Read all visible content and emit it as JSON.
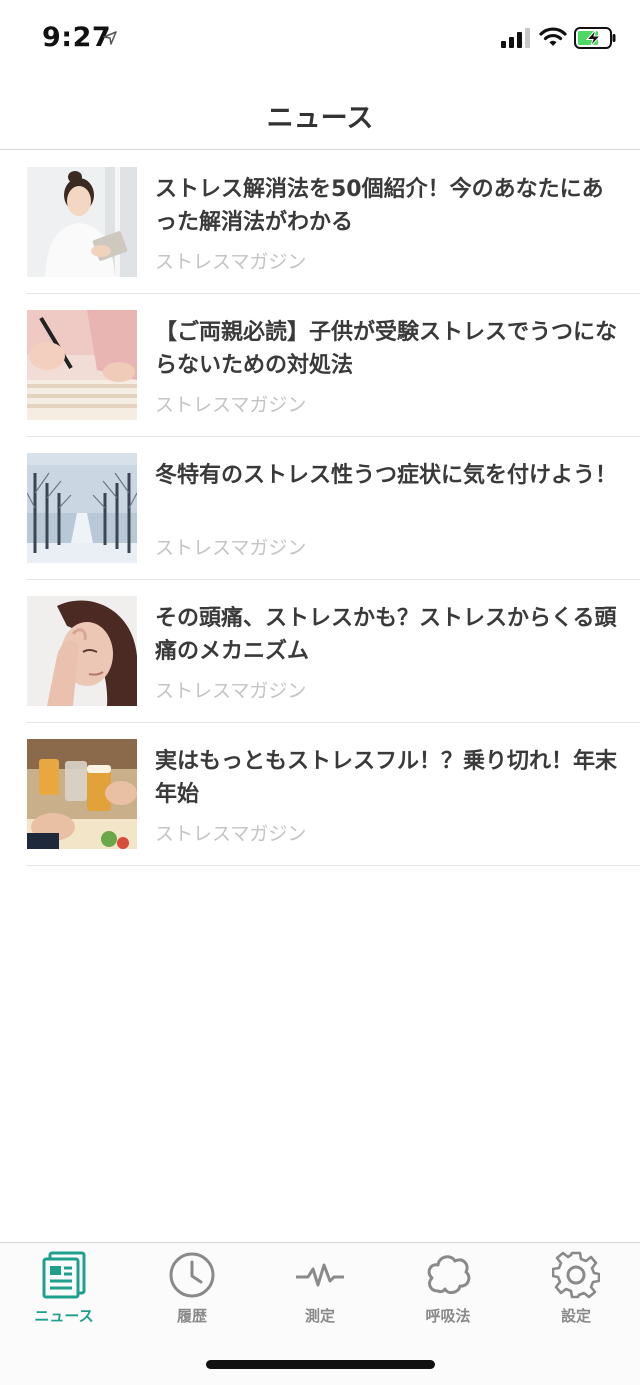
{
  "status_bar": {
    "time": "9:27"
  },
  "nav": {
    "title": "ニュース"
  },
  "news": [
    {
      "title": "ストレス解消法を50個紹介！今のあなたにあった解消法がわかる",
      "source": "ストレスマガジン"
    },
    {
      "title": "【ご両親必読】子供が受験ストレスでうつにならないための対処法",
      "source": "ストレスマガジン"
    },
    {
      "title": "冬特有のストレス性うつ症状に気を付けよう！",
      "source": "ストレスマガジン"
    },
    {
      "title": "その頭痛、ストレスかも？ストレスからくる頭痛のメカニズム",
      "source": "ストレスマガジン"
    },
    {
      "title": "実はもっともストレスフル！？乗り切れ！年末年始",
      "source": "ストレスマガジン"
    }
  ],
  "tabs": [
    {
      "label": "ニュース",
      "icon": "news-icon",
      "active": true
    },
    {
      "label": "履歴",
      "icon": "clock-icon",
      "active": false
    },
    {
      "label": "測定",
      "icon": "pulse-icon",
      "active": false
    },
    {
      "label": "呼吸法",
      "icon": "breath-icon",
      "active": false
    },
    {
      "label": "設定",
      "icon": "gear-icon",
      "active": false
    }
  ],
  "colors": {
    "accent": "#1fa08c",
    "inactive": "#8a8a8a",
    "source_text": "#c4c4c4",
    "battery_fill": "#4cd964"
  }
}
